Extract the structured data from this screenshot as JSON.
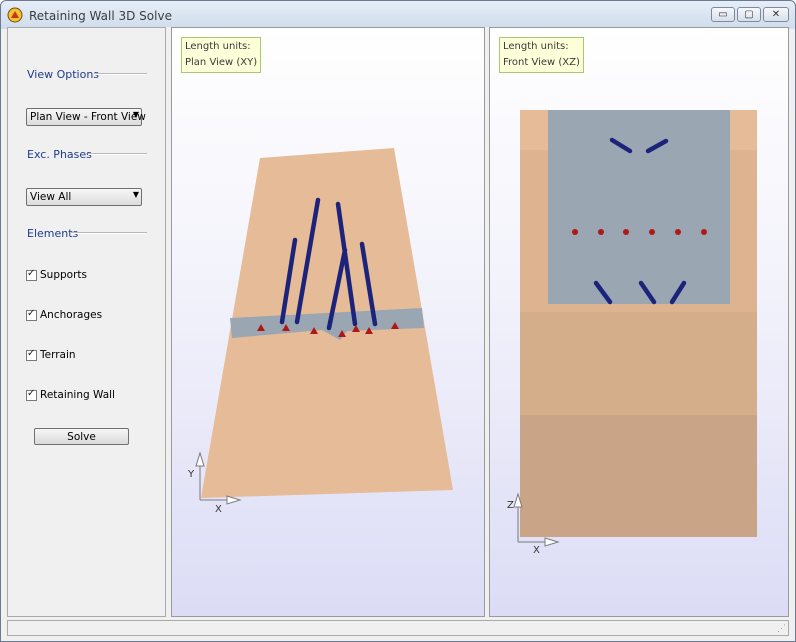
{
  "window": {
    "title": "Retaining Wall 3D Solve",
    "buttons": {
      "minimize": "▭",
      "maximize": "▢",
      "close": "✕"
    }
  },
  "sidebar": {
    "view_options_label": "View Options",
    "view_combo_value": "Plan View - Front View",
    "exc_phases_label": "Exc. Phases",
    "phase_combo_value": "View All",
    "elements_label": "Elements",
    "checks": [
      {
        "label": "Supports",
        "checked": true
      },
      {
        "label": "Anchorages",
        "checked": true
      },
      {
        "label": "Terrain",
        "checked": true
      },
      {
        "label": "Retaining Wall",
        "checked": true
      }
    ],
    "solve_label": "Solve"
  },
  "plan_view": {
    "units_line": "Length units:",
    "view_name": "Plan  View (XY)",
    "axis_x": "X",
    "axis_y": "Y"
  },
  "front_view": {
    "units_line": "Length units:",
    "view_name": "Front View (XZ)",
    "axis_x": "X",
    "axis_z": "Z"
  },
  "colors": {
    "terrain": "#e7bc97",
    "wall": "#9aa6b2",
    "anchor": "#1c237a",
    "support_marker": "#b01818"
  }
}
